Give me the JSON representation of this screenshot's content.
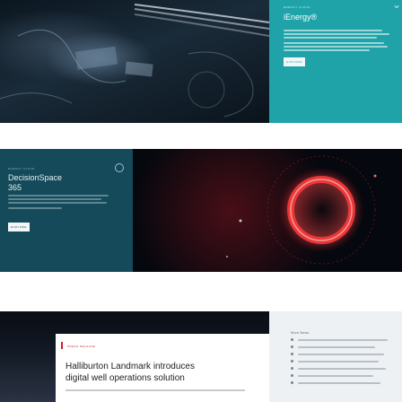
{
  "hero": {
    "ienergy_tag": "energy cloud",
    "ienergy_title": "iEnergy®",
    "ienergy_cta": "explore"
  },
  "decisionspace": {
    "tag": "energy cloud",
    "title_line1": "DecisionSpace",
    "title_line2": "365",
    "cta": "explore",
    "gear_icon": "gear-icon"
  },
  "news": {
    "press_tag": "press release",
    "headline_line1": "Halliburton Landmark introduces",
    "headline_line2": "digital well operations solution"
  },
  "more_news": {
    "title": "More News",
    "items": 7
  },
  "colors": {
    "teal": "#1fa3a8",
    "dark_teal": "#144a59",
    "red_accent": "#cc1e2c"
  }
}
